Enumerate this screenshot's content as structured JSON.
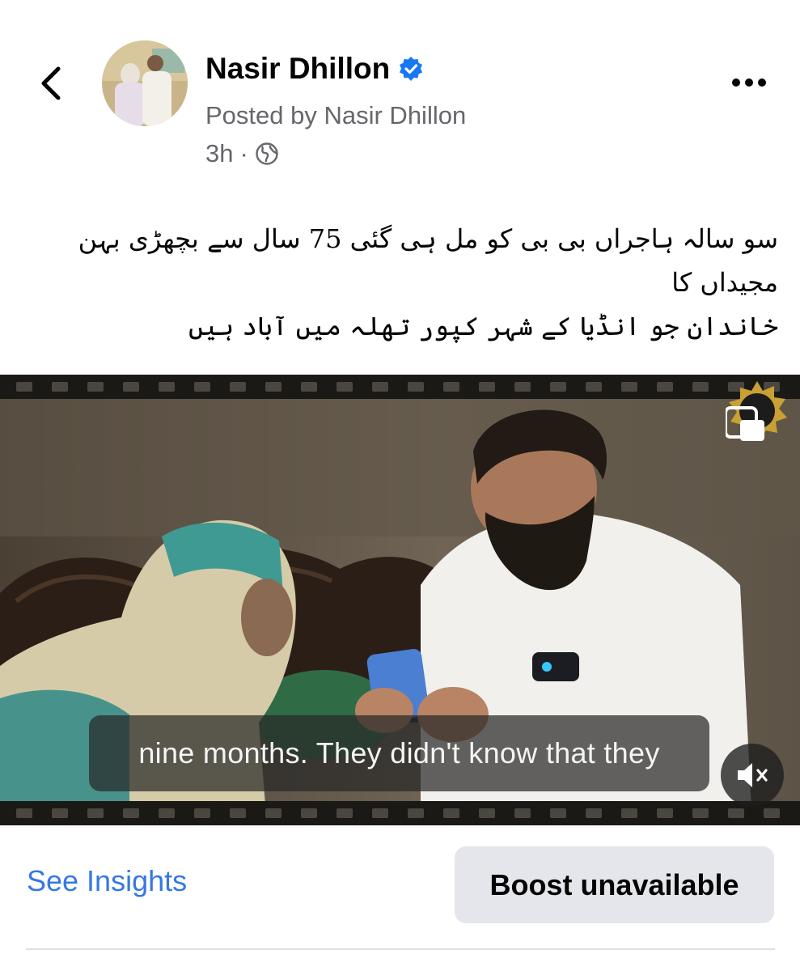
{
  "post": {
    "author_name": "Nasir Dhillon",
    "posted_by": "Posted by Nasir Dhillon",
    "time": "3h",
    "separator": "·",
    "caption_line1": "سو سالہ ہاجراں بی بی کو مل ہی گئی 75 سال سے بچھڑی بہن مجیداں کا",
    "caption_line2": "خاندان جو انڈیا کے شہر کپور تھلہ میں آباد ہیں"
  },
  "video": {
    "subtitle_text": "nine months. They didn't know that they",
    "muted": true
  },
  "actions": {
    "see_insights": "See Insights",
    "boost": "Boost unavailable"
  },
  "icons": {
    "back": "chevron-left-icon",
    "verified": "verified-badge-icon",
    "privacy": "globe-icon",
    "more": "more-options-icon",
    "mute": "speaker-muted-icon"
  },
  "colors": {
    "accent": "#3578e5",
    "verified": "#1877f2",
    "secondary_text": "#65676b",
    "button_bg": "#e4e6eb"
  }
}
